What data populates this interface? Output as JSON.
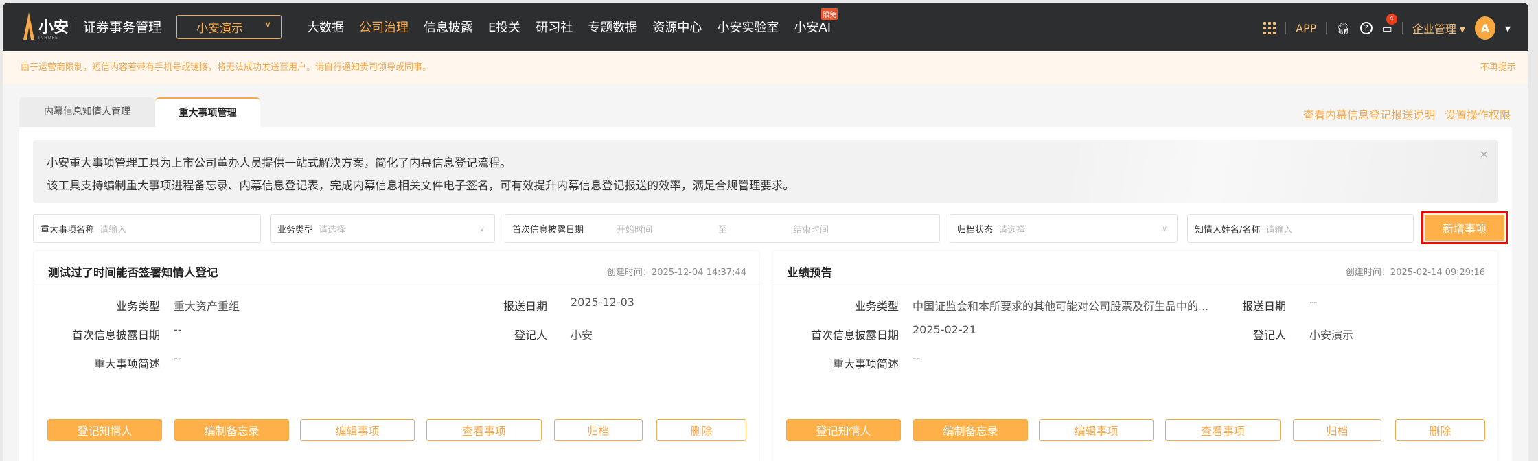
{
  "nav": {
    "logo_text": "小安",
    "logo_sub": "INHOPE",
    "system_name": "证券事务管理",
    "company": "小安演示",
    "menu": [
      "大数据",
      "公司治理",
      "信息披露",
      "E投关",
      "研习社",
      "专题数据",
      "资源中心",
      "小安实验室",
      "小安AI"
    ],
    "active_menu": "公司治理",
    "free_badge": "限免",
    "app": "APP",
    "message_count": "4",
    "enterprise": "企业管理"
  },
  "notice": {
    "text": "由于运营商限制，短信内容若带有手机号或链接，将无法成功发送至用户。请自行通知贵司领导或同事。",
    "dismiss": "不再提示"
  },
  "tabs": [
    "内幕信息知情人管理",
    "重大事项管理"
  ],
  "links": [
    "查看内幕信息登记报送说明",
    "设置操作权限"
  ],
  "intro": {
    "line1": "小安重大事项管理工具为上市公司董办人员提供一站式解决方案，简化了内幕信息登记流程。",
    "line2": "该工具支持编制重大事项进程备忘录、内幕信息登记表，完成内幕信息相关文件电子签名，可有效提升内幕信息登记报送的效率，满足合规管理要求。",
    "close": "×"
  },
  "filters": {
    "name_label": "重大事项名称",
    "name_ph": "请输入",
    "type_label": "业务类型",
    "type_ph": "请选择",
    "date_label": "首次信息披露日期",
    "date_start": "开始时间",
    "date_to": "至",
    "date_end": "结束时间",
    "status_label": "归档状态",
    "status_ph": "请选择",
    "person_label": "知情人姓名/名称",
    "person_ph": "请输入",
    "add": "新增事项"
  },
  "labels": {
    "type": "业务类型",
    "report_date": "报送日期",
    "first_date": "首次信息披露日期",
    "registrar": "登记人",
    "desc": "重大事项简述"
  },
  "buttons": [
    "登记知情人",
    "编制备忘录",
    "编辑事项",
    "查看事项",
    "归档",
    "删除"
  ],
  "cards": [
    {
      "title": "测试过了时间能否签署知情人登记",
      "created": "创建时间：2025-12-04 14:37:44",
      "type": "重大资产重组",
      "report_date": "2025-12-03",
      "first_date": "--",
      "registrar": "小安",
      "desc": "--"
    },
    {
      "title": "业绩预告",
      "created": "创建时间：2025-02-14 09:29:16",
      "type": "中国证监会和本所要求的其他可能对公司股票及衍生品中的...",
      "report_date": "--",
      "first_date": "2025-02-21",
      "registrar": "小安演示",
      "desc": "--"
    }
  ]
}
